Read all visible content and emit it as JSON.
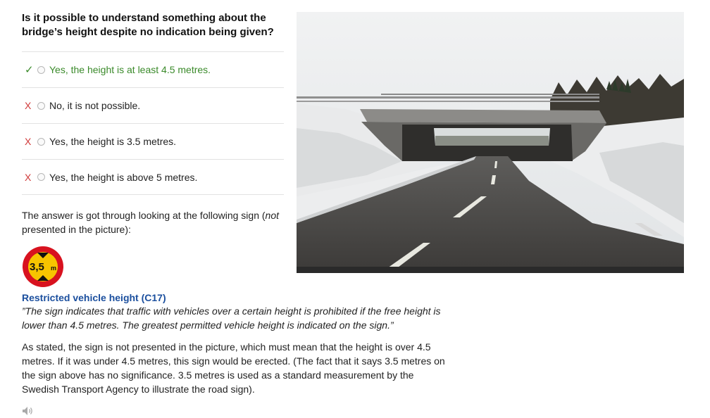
{
  "question": "Is it possible to understand something about the bridge’s height despite no indication being given?",
  "answers": [
    {
      "mark": "✓",
      "status": "correct",
      "label": "Yes, the height is at least 4.5 metres."
    },
    {
      "mark": "X",
      "status": "wrong",
      "label": "No, it is not possible."
    },
    {
      "mark": "X",
      "status": "wrong",
      "label": "Yes, the height is 3.5 metres."
    },
    {
      "mark": "X",
      "status": "wrong",
      "label": "Yes, the height is above 5 metres."
    }
  ],
  "explanation": {
    "intro_before": "The answer is got through looking at the following sign (",
    "intro_italic": "not",
    "intro_after": " presented in the picture):",
    "sign_text": "3,5",
    "sign_unit": "m",
    "sign_title": "Restricted vehicle height (C17)",
    "sign_quote": "”The sign indicates that traffic with vehicles over a certain height is prohibited if the free height is lower than 4.5 metres. The greatest permitted vehicle height is indicated on the sign.”",
    "body": "As stated, the sign is not presented in the picture, which must mean that the height is over 4.5 metres. If it was under 4.5 metres, this sign would be erected. (The fact that it says 3.5 metres on the sign above has no significance. 3.5 metres is used as a standard measurement by the Swedish Transport Agency to illustrate the road sign)."
  },
  "icons": {
    "speaker": "speaker-icon",
    "correct": "check-icon",
    "wrong": "cross-icon"
  },
  "colors": {
    "correct": "#3a8a2a",
    "wrong": "#d03a3a",
    "link": "#1b4f9e",
    "sign_red": "#d8121f",
    "sign_yellow": "#f7c400"
  }
}
